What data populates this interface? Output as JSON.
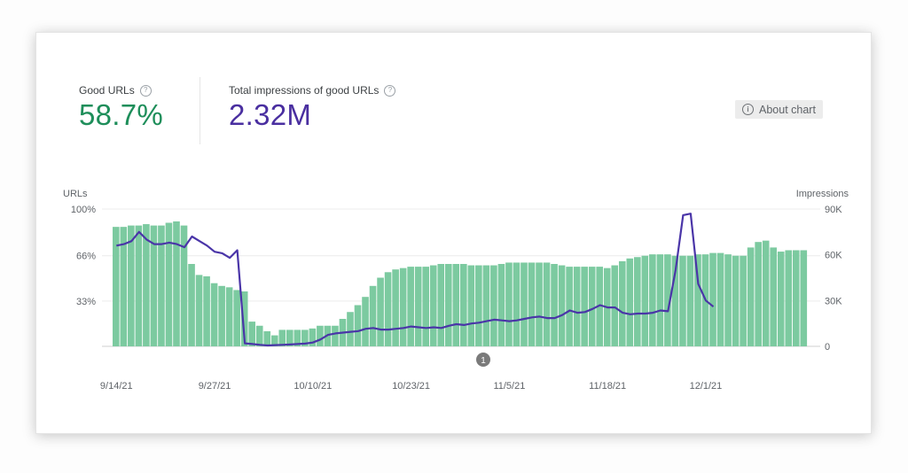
{
  "metrics": {
    "good_urls": {
      "label": "Good URLs",
      "value": "58.7%",
      "color": "#1e8e5a"
    },
    "impressions": {
      "label": "Total impressions of good URLs",
      "value": "2.32M",
      "color": "#4a2fa0"
    }
  },
  "about_chart": {
    "label": "About chart",
    "icon": "info-icon"
  },
  "help_icon": "?",
  "annotation_marker": "1",
  "chart_data": {
    "type": "bar+line",
    "title": "",
    "y_left": {
      "label": "URLs",
      "ticks": [
        "0",
        "33%",
        "66%",
        "100%"
      ],
      "tick_values": [
        0,
        33,
        66,
        100
      ],
      "range": [
        0,
        100
      ],
      "unit": "%"
    },
    "y_right": {
      "label": "Impressions",
      "ticks": [
        "0",
        "30K",
        "60K",
        "90K"
      ],
      "tick_values": [
        0,
        30000,
        60000,
        90000
      ],
      "range": [
        0,
        90000
      ]
    },
    "x_ticks": [
      "9/14/21",
      "9/27/21",
      "10/10/21",
      "10/23/21",
      "11/5/21",
      "11/18/21",
      "12/1/21"
    ],
    "x_tick_index": [
      0,
      13,
      26,
      39,
      52,
      65,
      78
    ],
    "grid": true,
    "series": [
      {
        "name": "Good URLs (%)",
        "type": "bar",
        "axis": "left",
        "color": "#7ccaa0",
        "values": [
          87,
          87,
          88,
          88,
          89,
          88,
          88,
          90,
          91,
          88,
          60,
          52,
          51,
          46,
          44,
          43,
          41,
          40,
          18,
          15,
          11,
          8,
          12,
          12,
          12,
          12,
          13,
          15,
          15,
          15,
          20,
          25,
          30,
          36,
          44,
          50,
          54,
          56,
          57,
          58,
          58,
          58,
          59,
          60,
          60,
          60,
          60,
          59,
          59,
          59,
          59,
          60,
          61,
          61,
          61,
          61,
          61,
          61,
          60,
          59,
          58,
          58,
          58,
          58,
          58,
          57,
          59,
          62,
          64,
          65,
          66,
          67,
          67,
          67,
          66,
          66,
          66,
          67,
          67,
          68,
          68,
          67,
          66,
          66,
          72,
          76,
          77,
          72,
          69,
          70,
          70,
          70
        ]
      },
      {
        "name": "Impressions",
        "type": "line",
        "axis": "right",
        "color": "#4a35a8",
        "values": [
          66000,
          67000,
          69000,
          75000,
          70000,
          67000,
          67000,
          68000,
          67000,
          65000,
          72000,
          69000,
          66000,
          62000,
          61000,
          58000,
          63000,
          2000,
          1500,
          1000,
          600,
          800,
          1000,
          1200,
          1500,
          1800,
          2500,
          4500,
          7500,
          8500,
          9000,
          9500,
          10000,
          11500,
          12000,
          11000,
          11000,
          11500,
          12000,
          13000,
          12500,
          12000,
          12500,
          12000,
          13500,
          14500,
          14000,
          15000,
          15500,
          16500,
          17500,
          17000,
          16500,
          17000,
          18000,
          19000,
          19500,
          18500,
          18500,
          20500,
          23500,
          22000,
          22500,
          24500,
          27000,
          25500,
          25500,
          22000,
          21000,
          21500,
          21500,
          22000,
          23500,
          23000,
          50000,
          86000,
          87000,
          41000,
          30000,
          26000
        ]
      }
    ]
  }
}
